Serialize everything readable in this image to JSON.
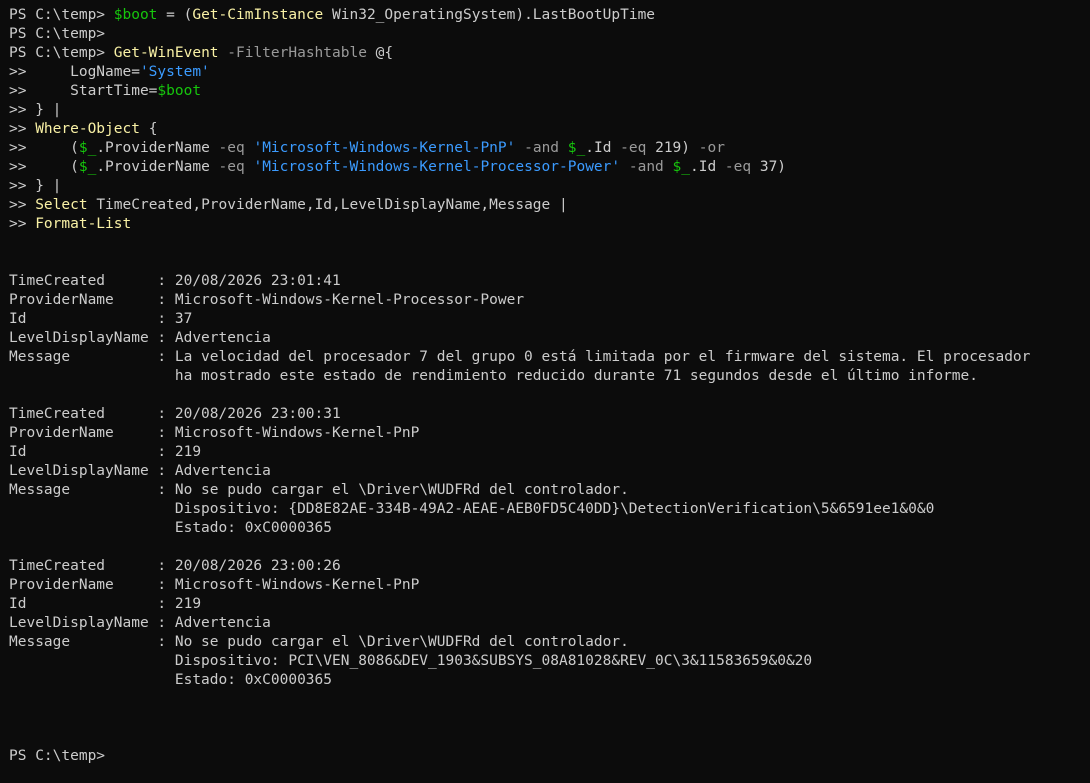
{
  "window": {
    "type": "powershell-terminal"
  },
  "colors": {
    "background": "#0c0c0c",
    "foreground": "#cccccc",
    "variable": "#16c60c",
    "command": "#f9f1a5",
    "parameter": "#9a9a9a",
    "string": "#3b9bff"
  },
  "lines": [
    [
      {
        "t": "prompt",
        "v": "PS C:\\temp> "
      },
      {
        "t": "var",
        "v": "$boot"
      },
      {
        "t": "plain",
        "v": " = ("
      },
      {
        "t": "cmd",
        "v": "Get-CimInstance"
      },
      {
        "t": "plain",
        "v": " Win32_OperatingSystem).LastBootUpTime"
      }
    ],
    [
      {
        "t": "prompt",
        "v": "PS C:\\temp>"
      }
    ],
    [
      {
        "t": "prompt",
        "v": "PS C:\\temp> "
      },
      {
        "t": "cmd",
        "v": "Get-WinEvent"
      },
      {
        "t": "param",
        "v": " -FilterHashtable"
      },
      {
        "t": "plain",
        "v": " @{"
      }
    ],
    [
      {
        "t": "prompt",
        "v": ">>     "
      },
      {
        "t": "plain",
        "v": "LogName="
      },
      {
        "t": "str",
        "v": "'System'"
      }
    ],
    [
      {
        "t": "prompt",
        "v": ">>     "
      },
      {
        "t": "plain",
        "v": "StartTime="
      },
      {
        "t": "var",
        "v": "$boot"
      }
    ],
    [
      {
        "t": "prompt",
        "v": ">> "
      },
      {
        "t": "plain",
        "v": "} |"
      }
    ],
    [
      {
        "t": "prompt",
        "v": ">> "
      },
      {
        "t": "cmd",
        "v": "Where-Object"
      },
      {
        "t": "plain",
        "v": " {"
      }
    ],
    [
      {
        "t": "prompt",
        "v": ">>     "
      },
      {
        "t": "plain",
        "v": "("
      },
      {
        "t": "var",
        "v": "$_"
      },
      {
        "t": "plain",
        "v": ".ProviderName"
      },
      {
        "t": "param",
        "v": " -eq"
      },
      {
        "t": "plain",
        "v": " "
      },
      {
        "t": "str",
        "v": "'Microsoft-Windows-Kernel-PnP'"
      },
      {
        "t": "param",
        "v": " -and"
      },
      {
        "t": "plain",
        "v": " "
      },
      {
        "t": "var",
        "v": "$_"
      },
      {
        "t": "plain",
        "v": ".Id"
      },
      {
        "t": "param",
        "v": " -eq"
      },
      {
        "t": "plain",
        "v": " 219)"
      },
      {
        "t": "param",
        "v": " -or"
      }
    ],
    [
      {
        "t": "prompt",
        "v": ">>     "
      },
      {
        "t": "plain",
        "v": "("
      },
      {
        "t": "var",
        "v": "$_"
      },
      {
        "t": "plain",
        "v": ".ProviderName"
      },
      {
        "t": "param",
        "v": " -eq"
      },
      {
        "t": "plain",
        "v": " "
      },
      {
        "t": "str",
        "v": "'Microsoft-Windows-Kernel-Processor-Power'"
      },
      {
        "t": "param",
        "v": " -and"
      },
      {
        "t": "plain",
        "v": " "
      },
      {
        "t": "var",
        "v": "$_"
      },
      {
        "t": "plain",
        "v": ".Id"
      },
      {
        "t": "param",
        "v": " -eq"
      },
      {
        "t": "plain",
        "v": " 37)"
      }
    ],
    [
      {
        "t": "prompt",
        "v": ">> "
      },
      {
        "t": "plain",
        "v": "} |"
      }
    ],
    [
      {
        "t": "prompt",
        "v": ">> "
      },
      {
        "t": "cmd",
        "v": "Select"
      },
      {
        "t": "plain",
        "v": " TimeCreated,ProviderName,Id,LevelDisplayName,Message |"
      }
    ],
    [
      {
        "t": "prompt",
        "v": ">> "
      },
      {
        "t": "cmd",
        "v": "Format-List"
      }
    ],
    [],
    [],
    [
      {
        "t": "plain",
        "v": "TimeCreated      : 20/08/2026 23:01:41"
      }
    ],
    [
      {
        "t": "plain",
        "v": "ProviderName     : Microsoft-Windows-Kernel-Processor-Power"
      }
    ],
    [
      {
        "t": "plain",
        "v": "Id               : 37"
      }
    ],
    [
      {
        "t": "plain",
        "v": "LevelDisplayName : Advertencia"
      }
    ],
    [
      {
        "t": "plain",
        "v": "Message          : La velocidad del procesador 7 del grupo 0 está limitada por el firmware del sistema. El procesador"
      }
    ],
    [
      {
        "t": "plain",
        "v": "                   ha mostrado este estado de rendimiento reducido durante 71 segundos desde el último informe."
      }
    ],
    [],
    [
      {
        "t": "plain",
        "v": "TimeCreated      : 20/08/2026 23:00:31"
      }
    ],
    [
      {
        "t": "plain",
        "v": "ProviderName     : Microsoft-Windows-Kernel-PnP"
      }
    ],
    [
      {
        "t": "plain",
        "v": "Id               : 219"
      }
    ],
    [
      {
        "t": "plain",
        "v": "LevelDisplayName : Advertencia"
      }
    ],
    [
      {
        "t": "plain",
        "v": "Message          : No se pudo cargar el \\Driver\\WUDFRd del controlador."
      }
    ],
    [
      {
        "t": "plain",
        "v": "                   Dispositivo: {DD8E82AE-334B-49A2-AEAE-AEB0FD5C40DD}\\DetectionVerification\\5&6591ee1&0&0"
      }
    ],
    [
      {
        "t": "plain",
        "v": "                   Estado: 0xC0000365"
      }
    ],
    [],
    [
      {
        "t": "plain",
        "v": "TimeCreated      : 20/08/2026 23:00:26"
      }
    ],
    [
      {
        "t": "plain",
        "v": "ProviderName     : Microsoft-Windows-Kernel-PnP"
      }
    ],
    [
      {
        "t": "plain",
        "v": "Id               : 219"
      }
    ],
    [
      {
        "t": "plain",
        "v": "LevelDisplayName : Advertencia"
      }
    ],
    [
      {
        "t": "plain",
        "v": "Message          : No se pudo cargar el \\Driver\\WUDFRd del controlador."
      }
    ],
    [
      {
        "t": "plain",
        "v": "                   Dispositivo: PCI\\VEN_8086&DEV_1903&SUBSYS_08A81028&REV_0C\\3&11583659&0&20"
      }
    ],
    [
      {
        "t": "plain",
        "v": "                   Estado: 0xC0000365"
      }
    ],
    [],
    [],
    [],
    [
      {
        "t": "prompt",
        "v": "PS C:\\temp>"
      }
    ]
  ]
}
